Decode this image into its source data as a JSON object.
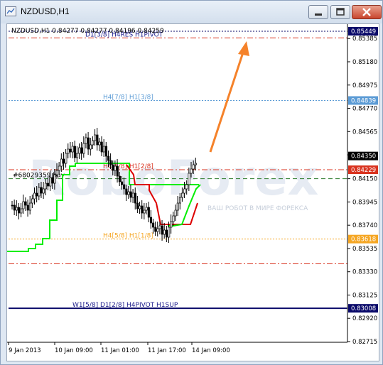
{
  "window": {
    "title": "NZDUSD,H1"
  },
  "chart_info": {
    "symbol_line": "NZDUSD,H1  0.84277 0.84277 0.84196 0.84259"
  },
  "colors": {
    "background": "#ffffff",
    "blue_line": "#5b9bd5",
    "orange_line": "#f5a623",
    "red_dash": "#d9331f",
    "navy_line": "#0a0a6a",
    "green_line": "#00ee00",
    "trail_red": "#dd0000",
    "arrow": "#f5822a",
    "candle": "#000000"
  },
  "levels": [
    {
      "name": "d1-38-h4res-h1pivot",
      "text": "D1[3/8] H4RES H1PIVOT",
      "price": 0.8539,
      "style": "red-dashdot"
    },
    {
      "name": "h4-78-h1-38",
      "text": "H4[7/8] H1[3/8]",
      "price": 0.84839,
      "style": "blue-dotted"
    },
    {
      "name": "h4-68-h1-28",
      "text": "H4[6/8] H1[2/8]",
      "price": 0.84229,
      "style": "red-dashdot"
    },
    {
      "name": "h4-58-h1-18",
      "text": "H4[5/8] H1[1/8]",
      "price": 0.83618,
      "style": "orange-dotted"
    },
    {
      "name": "lower-red-dash",
      "text": "",
      "price": 0.834,
      "style": "red-dashdot"
    },
    {
      "name": "w1-58-d1-28-h4pivot-h1sup",
      "text": "W1[5/8] D1[2/8] H4PIVOT H1SUP",
      "price": 0.83008,
      "style": "navy-solid"
    }
  ],
  "order": {
    "text": "#68029359 buy",
    "price": 0.8415
  },
  "price_axis": {
    "ticks": [
      "0.85385",
      "0.85180",
      "0.84975",
      "0.84770",
      "0.84565",
      "0.84360",
      "0.84150",
      "0.83945",
      "0.83740",
      "0.83535",
      "0.83330",
      "0.83125",
      "0.82920",
      "0.82715"
    ],
    "tick_values": [
      0.85385,
      0.8518,
      0.84975,
      0.8477,
      0.84565,
      0.8436,
      0.8415,
      0.83945,
      0.8374,
      0.83535,
      0.8333,
      0.83125,
      0.8292,
      0.82715
    ],
    "labels": [
      {
        "text": "0.85449",
        "price": 0.85449,
        "bg": "#0a0a6a"
      },
      {
        "text": "0.84839",
        "price": 0.84839,
        "bg": "#5b9bd5"
      },
      {
        "text": "0.84350",
        "price": 0.8435,
        "bg": "#000000"
      },
      {
        "text": "0.84229",
        "price": 0.84229,
        "bg": "#d9331f"
      },
      {
        "text": "0.83618",
        "price": 0.83618,
        "bg": "#f5a623"
      },
      {
        "text": "0.83008",
        "price": 0.83008,
        "bg": "#0a0a6a"
      }
    ]
  },
  "time_axis": {
    "labels": [
      "9 Jan 2013",
      "10 Jan 09:00",
      "11 Jan 01:00",
      "11 Jan 17:00",
      "14 Jan 09:00"
    ]
  },
  "watermark": {
    "brand": "RoboForex",
    "sub": "ВАШ РОБОТ В МИРЕ ФОРЕКСА"
  }
}
